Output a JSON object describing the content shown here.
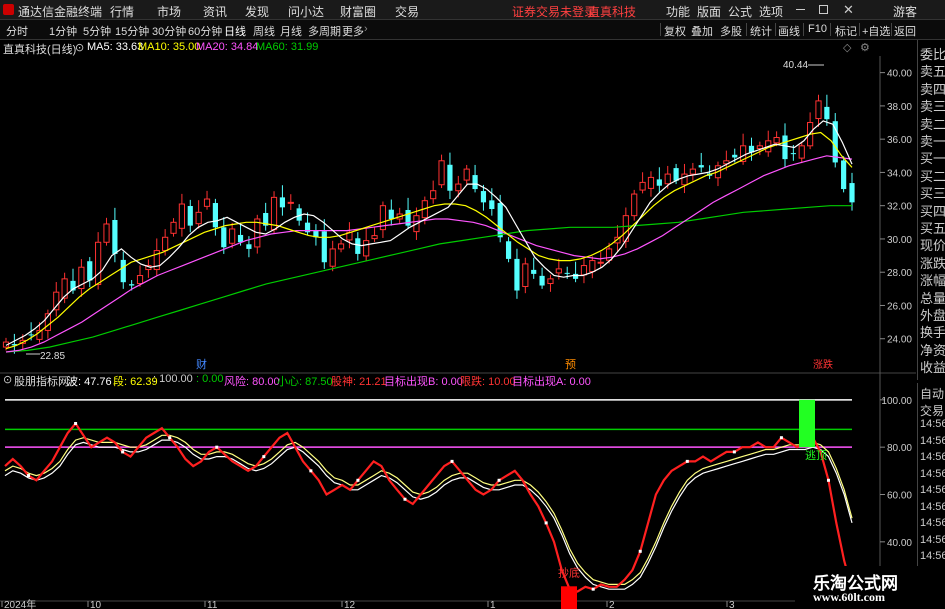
{
  "menubar": {
    "logo_text": "通达信金融终端",
    "items": [
      "行情",
      "市场",
      "资讯",
      "发现",
      "问小达",
      "财富圈",
      "交易"
    ],
    "notice": "证券交易未登录",
    "stock_name": "直真科技",
    "right_items": [
      "功能",
      "版面",
      "公式",
      "选项"
    ],
    "guest": "游客",
    "window_controls": [
      "minimize-icon",
      "maximize-icon",
      "close-icon"
    ]
  },
  "toolbar": {
    "periods": [
      "分时",
      "1分钟",
      "5分钟",
      "15分钟",
      "30分钟",
      "60分钟",
      "日线",
      "周线",
      "月线",
      "多周期",
      "更多"
    ],
    "active_period": "日线",
    "right_buttons": [
      "复权",
      "叠加",
      "多股",
      "统计",
      "画线",
      "F10",
      "标记",
      "+自选",
      "返回"
    ]
  },
  "info": {
    "title": "直真科技(日线)",
    "ma5": "MA5: 33.63",
    "ma10": "MA10: 35.00",
    "ma20": "MA20: 34.84",
    "ma60": "MA60: 31.99"
  },
  "sidepanel": {
    "items": [
      "委比",
      "卖五",
      "卖四",
      "卖三",
      "卖二",
      "卖一",
      "买一",
      "买二",
      "买三",
      "买四",
      "买五",
      "现价",
      "涨跌",
      "涨幅",
      "总量",
      "外盘",
      "换手",
      "净资",
      "收益"
    ]
  },
  "sidepanel2": {
    "items": [
      "自动",
      "交易",
      "14:56",
      "14:56",
      "14:56",
      "14:56",
      "14:56",
      "14:56",
      "14:56",
      "14:56",
      "14:56",
      "14:56"
    ]
  },
  "indicator_bar": {
    "name": "股朋指标网",
    "wave": "波: 47.76",
    "segment": "段: 62.39",
    "v100": ": 100.00",
    "v0": ": 0.00",
    "risk": "风险: 80.00",
    "careful": "小心: 87.50",
    "base": "股神: 21.21",
    "targetB": "目标出现B: 0.00",
    "stop": "限跌: 10.00",
    "targetA": "目标出现A: 0.00"
  },
  "annotations": {
    "high": "40.44",
    "low": "22.85",
    "fin_marker": "财",
    "forecast_marker": "预",
    "limit_marker": "涨跌",
    "buy_label": "抄底",
    "sell_label": "逃顶"
  },
  "watermark": {
    "line1": "乐淘公式网",
    "line2": "www.60lt.com"
  },
  "colors": {
    "up": "#ff3232",
    "down": "#54ffff",
    "ma5": "#ffffff",
    "ma10": "#ffff00",
    "ma20": "#ff55ff",
    "ma60": "#00cc00",
    "wave": "#ff2020",
    "buy_bar": "#ff0000",
    "sell_bar": "#22ff22"
  },
  "chart_data": [
    {
      "type": "candlestick",
      "title": "直真科技(日线)",
      "ylim": [
        22,
        41
      ],
      "y_ticks": [
        24,
        26,
        28,
        30,
        32,
        34,
        36,
        38,
        40
      ],
      "x_ticks": [
        "2024年",
        "10",
        "11",
        "12",
        "1",
        "2",
        "3"
      ],
      "high_label": 40.44,
      "low_label": 22.85,
      "close_path": [
        23.8,
        23.6,
        23.9,
        24.2,
        24.5,
        25.5,
        26.8,
        27.6,
        26.9,
        28.3,
        27.5,
        29.8,
        30.9,
        29.1,
        27.4,
        27.2,
        27.8,
        28.4,
        29.3,
        30.1,
        31.0,
        32.1,
        30.8,
        31.6,
        32.4,
        30.7,
        29.5,
        30.6,
        29.8,
        29.4,
        31.2,
        30.8,
        32.5,
        31.9,
        32.2,
        31.1,
        30.4,
        30.1,
        28.6,
        29.4,
        29.7,
        30.4,
        29.1,
        29.9,
        30.2,
        32.0,
        31.2,
        31.5,
        30.8,
        31.4,
        32.3,
        32.9,
        34.7,
        32.9,
        33.3,
        34.2,
        33.0,
        32.2,
        31.8,
        30.1,
        28.8,
        26.9,
        28.5,
        27.9,
        27.2,
        27.6,
        28.2,
        27.9,
        27.6,
        28.4,
        28.7,
        28.6,
        29.4,
        30.1,
        31.4,
        32.7,
        33.4,
        33.7,
        33.2,
        33.9,
        33.5,
        33.9,
        34.2,
        34.3,
        33.8,
        34.4,
        34.7,
        34.9,
        35.6,
        35.2,
        35.6,
        35.9,
        36.1,
        34.8,
        35.1,
        35.6,
        37.0,
        38.3,
        37.2,
        34.6,
        33.0,
        32.2
      ],
      "ma5": [
        23.6,
        23.9,
        24.2,
        24.6,
        25.1,
        25.8,
        26.5,
        27.0,
        27.3,
        27.6,
        28.1,
        29.0,
        29.4,
        28.9,
        28.5,
        28.3,
        28.4,
        28.9,
        29.5,
        30.2,
        30.7,
        31.0,
        31.1,
        31.3,
        31.0,
        30.7,
        30.4,
        30.3,
        30.6,
        31.0,
        31.3,
        31.5,
        31.4,
        31.0,
        30.5,
        30.0,
        29.7,
        29.6,
        29.7,
        29.8,
        29.9,
        30.3,
        30.7,
        31.0,
        31.3,
        31.6,
        31.9,
        32.6,
        33.3,
        33.3,
        33.0,
        32.5,
        31.9,
        30.9,
        29.9,
        28.9,
        28.3,
        27.8,
        27.7,
        27.8,
        27.8,
        28.0,
        28.3,
        28.8,
        29.5,
        30.4,
        31.3,
        32.2,
        32.8,
        33.3,
        33.6,
        33.8,
        33.9,
        34.0,
        34.2,
        34.5,
        34.8,
        35.1,
        35.3,
        35.5,
        35.7,
        35.6,
        35.5,
        35.9,
        36.6,
        37.1,
        36.9,
        35.8,
        34.5
      ],
      "ma10": [
        23.4,
        23.6,
        23.9,
        24.3,
        24.8,
        25.3,
        25.9,
        26.5,
        27.0,
        27.4,
        27.8,
        28.2,
        28.6,
        28.8,
        29.0,
        29.2,
        29.5,
        29.8,
        30.1,
        30.4,
        30.6,
        30.8,
        30.9,
        31.0,
        31.0,
        30.9,
        30.8,
        30.6,
        30.4,
        30.2,
        30.1,
        30.1,
        30.2,
        30.4,
        30.6,
        30.8,
        31.0,
        31.2,
        31.4,
        31.6,
        31.8,
        32.0,
        32.1,
        32.1,
        32.0,
        31.7,
        31.3,
        30.8,
        30.3,
        29.8,
        29.4,
        29.0,
        28.8,
        28.7,
        28.7,
        28.8,
        29.0,
        29.3,
        29.7,
        30.2,
        30.8,
        31.4,
        32.0,
        32.5,
        32.9,
        33.2,
        33.5,
        33.8,
        34.0,
        34.3,
        34.6,
        34.9,
        35.2,
        35.5,
        35.7,
        35.9,
        36.1,
        36.3,
        36.4,
        35.9,
        35.0,
        34.3
      ],
      "ma20": [
        23.2,
        23.3,
        23.5,
        23.8,
        24.2,
        24.6,
        25.0,
        25.5,
        26.0,
        26.5,
        27.0,
        27.4,
        27.8,
        28.1,
        28.4,
        28.7,
        29.0,
        29.3,
        29.6,
        29.9,
        30.1,
        30.3,
        30.4,
        30.5,
        30.5,
        30.5,
        30.5,
        30.5,
        30.6,
        30.7,
        30.8,
        30.9,
        31.0,
        31.1,
        31.2,
        31.2,
        31.1,
        31.0,
        30.8,
        30.5,
        30.2,
        29.9,
        29.6,
        29.4,
        29.2,
        29.0,
        28.9,
        28.8,
        28.9,
        29.1,
        29.4,
        29.8,
        30.2,
        30.7,
        31.2,
        31.7,
        32.2,
        32.6,
        33.0,
        33.4,
        33.8,
        34.1,
        34.4,
        34.6,
        34.8,
        35.0,
        34.9,
        34.8
      ],
      "ma60": [
        23.2,
        23.3,
        23.5,
        23.8,
        24.1,
        24.5,
        24.9,
        25.3,
        25.7,
        26.1,
        26.5,
        26.9,
        27.3,
        27.6,
        27.9,
        28.2,
        28.5,
        28.8,
        29.1,
        29.4,
        29.7,
        29.9,
        30.1,
        30.3,
        30.5,
        30.6,
        30.7,
        30.7,
        30.7,
        30.8,
        30.9,
        31.0,
        31.2,
        31.4,
        31.6,
        31.7,
        31.8,
        31.9,
        32.0,
        32.0
      ]
    },
    {
      "type": "line",
      "title": "股朋指标网",
      "ylim": [
        15,
        105
      ],
      "y_ticks": [
        20,
        40,
        60,
        80,
        100
      ],
      "levels": {
        "top": 100,
        "careful": 87.5,
        "risk": 80,
        "bottom": 10,
        "zero": 0
      },
      "series": [
        {
          "name": "波",
          "values": [
            72,
            75,
            72,
            68,
            66,
            70,
            74,
            80,
            86,
            90,
            85,
            80,
            82,
            84,
            82,
            78,
            76,
            80,
            84,
            86,
            88,
            84,
            80,
            75,
            72,
            74,
            78,
            80,
            77,
            74,
            72,
            70,
            72,
            76,
            80,
            84,
            86,
            80,
            74,
            70,
            66,
            60,
            62,
            64,
            62,
            66,
            70,
            74,
            72,
            66,
            62,
            58,
            56,
            60,
            64,
            68,
            72,
            74,
            70,
            66,
            62,
            60,
            62,
            66,
            68,
            70,
            66,
            60,
            55,
            48,
            40,
            28,
            20,
            19,
            21,
            20,
            22,
            21,
            21,
            24,
            28,
            36,
            48,
            60,
            66,
            70,
            72,
            74,
            74,
            76,
            74,
            76,
            78,
            78,
            80,
            80,
            82,
            80,
            80,
            84,
            82,
            80,
            82,
            84,
            78,
            66,
            48,
            32,
            20
          ]
        },
        {
          "name": "段",
          "values": [
            70,
            72,
            71,
            69,
            68,
            69,
            71,
            74,
            79,
            83,
            84,
            83,
            82,
            82,
            82,
            81,
            80,
            80,
            81,
            83,
            85,
            85,
            84,
            82,
            79,
            77,
            77,
            78,
            78,
            77,
            75,
            73,
            72,
            73,
            75,
            78,
            81,
            82,
            80,
            77,
            74,
            70,
            67,
            66,
            64,
            64,
            66,
            68,
            70,
            69,
            67,
            64,
            61,
            60,
            61,
            63,
            66,
            68,
            69,
            69,
            67,
            65,
            64,
            64,
            65,
            66,
            66,
            64,
            61,
            57,
            52,
            45,
            37,
            31,
            27,
            24,
            23,
            22,
            22,
            22,
            24,
            27,
            33,
            40,
            48,
            55,
            61,
            66,
            69,
            71,
            72,
            73,
            74,
            75,
            76,
            77,
            78,
            79,
            79,
            80,
            81,
            81,
            81,
            82,
            81,
            78,
            71,
            62,
            50
          ]
        }
      ],
      "signals": [
        {
          "label": "抄底",
          "at_value": 21.21
        },
        {
          "label": "逃顶",
          "at_value": 80
        }
      ]
    }
  ]
}
